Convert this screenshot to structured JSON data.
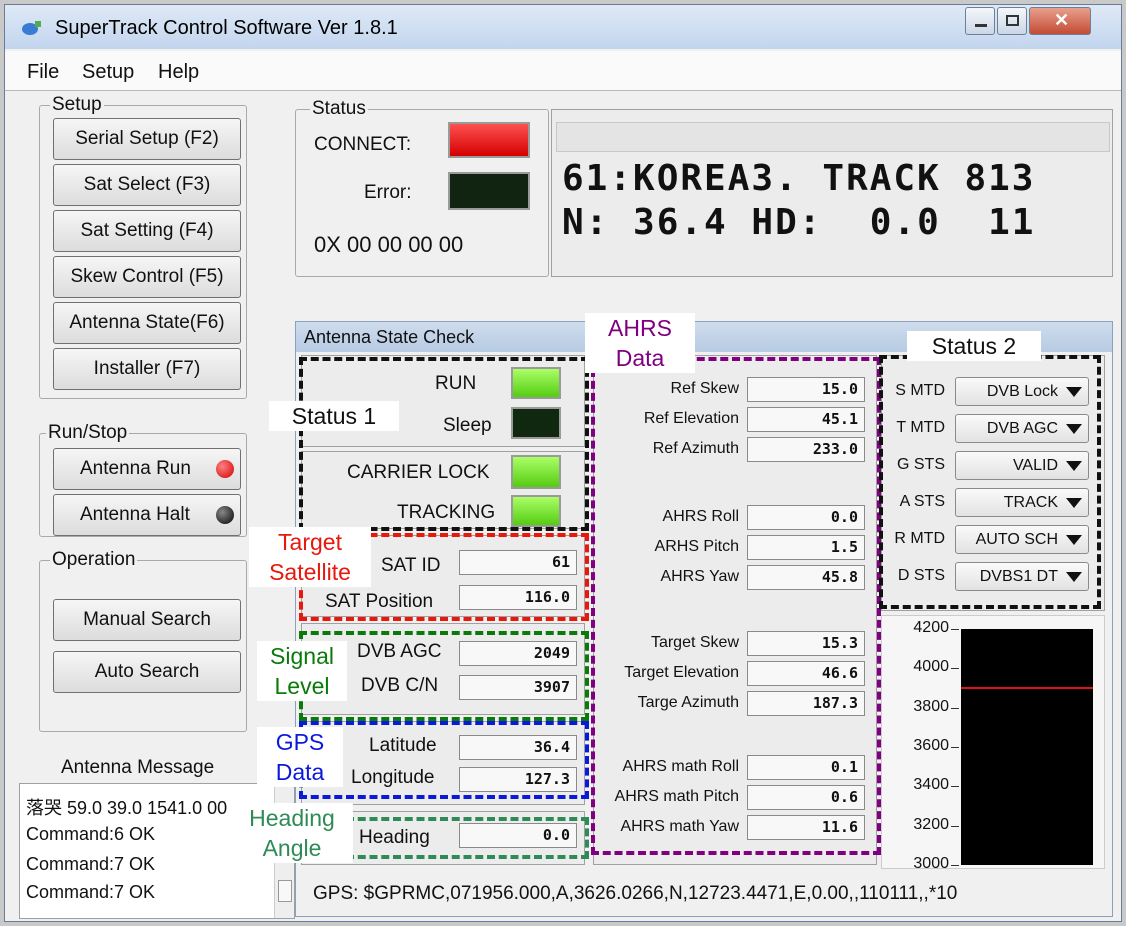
{
  "window": {
    "title": "SuperTrack Control Software Ver 1.8.1"
  },
  "menu": [
    "File",
    "Setup",
    "Help"
  ],
  "setup": {
    "label": "Setup",
    "buttons": [
      "Serial Setup (F2)",
      "Sat Select  (F3)",
      "Sat Setting  (F4)",
      "Skew Control (F5)",
      "Antenna State(F6)",
      "Installer    (F7)"
    ]
  },
  "runstop": {
    "label": "Run/Stop",
    "run": "Antenna Run",
    "halt": "Antenna Halt"
  },
  "operation": {
    "label": "Operation",
    "manual": "Manual Search",
    "auto": "Auto Search"
  },
  "message": {
    "title": "Antenna Message",
    "lines": [
      "落哭 59.0 39.0 1541.0 00",
      "Command:6 OK",
      "Command:7 OK",
      "Command:7 OK"
    ]
  },
  "status": {
    "label": "Status",
    "connect": "CONNECT:",
    "error": "Error:",
    "code": "0X 00 00 00 00"
  },
  "lcd": {
    "line1": "61:KOREA3. TRACK 813",
    "line2": "N: 36.4 HD:  0.0  11"
  },
  "state_check": {
    "title": "Antenna State Check",
    "status1": {
      "run": "RUN",
      "sleep": "Sleep",
      "carrier": "CARRIER LOCK",
      "tracking": "TRACKING"
    },
    "target": {
      "sat_id_label": "SAT ID",
      "sat_id": "61",
      "sat_pos_label": "SAT Position",
      "sat_pos": "116.0"
    },
    "signal": {
      "agc_label": "DVB AGC",
      "agc": "2049",
      "cn_label": "DVB C/N",
      "cn": "3907"
    },
    "gps": {
      "lat_label": "Latitude",
      "lat": "36.4",
      "lon_label": "Longitude",
      "lon": "127.3"
    },
    "heading": {
      "label": "Heading",
      "value": "0.0"
    },
    "ahrs": [
      {
        "label": "Ref Skew",
        "value": "15.0"
      },
      {
        "label": "Ref Elevation",
        "value": "45.1"
      },
      {
        "label": "Ref Azimuth",
        "value": "233.0"
      },
      {
        "label": "AHRS Roll",
        "value": "0.0"
      },
      {
        "label": "ARHS Pitch",
        "value": "1.5"
      },
      {
        "label": "AHRS Yaw",
        "value": "45.8"
      },
      {
        "label": "Target Skew",
        "value": "15.3"
      },
      {
        "label": "Target Elevation",
        "value": "46.6"
      },
      {
        "label": "Targe Azimuth",
        "value": "187.3"
      },
      {
        "label": "AHRS math Roll",
        "value": "0.1"
      },
      {
        "label": "AHRS math Pitch",
        "value": "0.6"
      },
      {
        "label": "AHRS math Yaw",
        "value": "11.6"
      }
    ],
    "status2": [
      {
        "label": "S MTD",
        "value": "DVB Lock"
      },
      {
        "label": "T MTD",
        "value": "DVB AGC"
      },
      {
        "label": "G STS",
        "value": "VALID"
      },
      {
        "label": "A STS",
        "value": "TRACK"
      },
      {
        "label": "R MTD",
        "value": "AUTO SCH"
      },
      {
        "label": "D STS",
        "value": "DVBS1 DT"
      }
    ],
    "graph": {
      "ticks": [
        "4200",
        "4000",
        "3800",
        "3600",
        "3400",
        "3200",
        "3000"
      ],
      "signal_level": 3907
    },
    "gps_sentence": "GPS: $GPRMC,071956.000,A,3626.0266,N,12723.4471,E,0.00,,110111,,*10"
  },
  "annotations": {
    "ahrs": [
      "AHRS",
      "Data"
    ],
    "status2": "Status 2",
    "status1": "Status 1",
    "target": [
      "Target",
      "Satellite"
    ],
    "signal": [
      "Signal",
      "Level"
    ],
    "gps": [
      "GPS",
      "Data"
    ],
    "heading": [
      "Heading",
      "Angle"
    ]
  },
  "colors": {
    "connect_led": "#e81010",
    "led_on": "#66dd22",
    "led_off": "#102810",
    "ahrs": "#800080",
    "status": "#111111",
    "target": "#e8180c",
    "signal": "#0a7a0a",
    "gps": "#0a1ad8",
    "heading": "#2e8b57"
  }
}
